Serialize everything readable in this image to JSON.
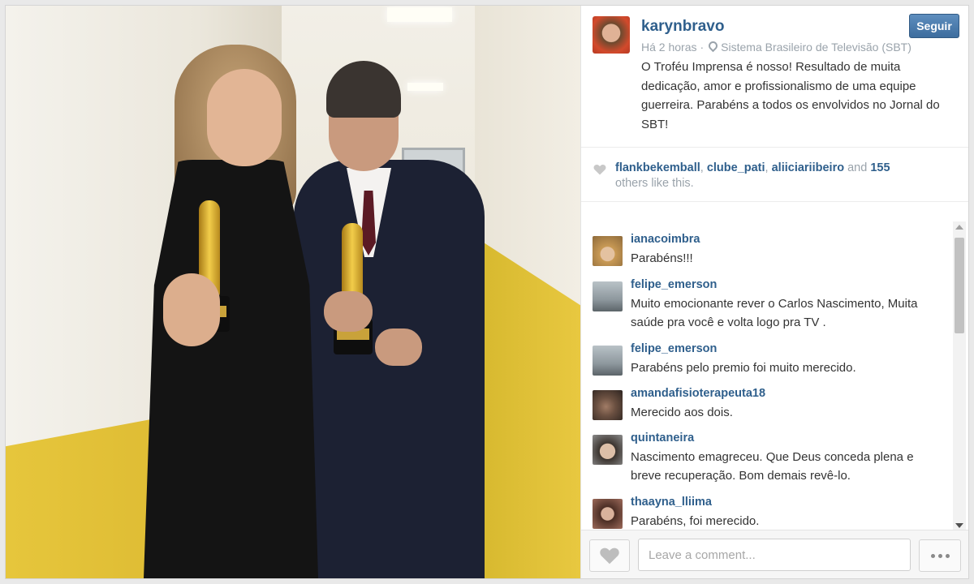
{
  "post": {
    "username": "karynbravo",
    "follow_label": "Seguir",
    "time_ago": "Há 2 horas",
    "location": "Sistema Brasileiro de Televisão (SBT)",
    "caption": "O Troféu Imprensa é nosso! Resultado de muita dedicação, amor e profissionalismo de uma equipe guerreira. Parabéns a todos os envolvidos no Jornal do SBT!",
    "photo_icon": "photo-two-people-holding-trophies"
  },
  "likes": {
    "user1": "flankbekemball",
    "user2": "clube_pati",
    "user3": "aliiciariibeiro",
    "and_label": "and",
    "others_count": "155",
    "others_suffix": "others like this."
  },
  "comments": [
    {
      "user": "ianacoimbra",
      "text": "Parabéns!!!"
    },
    {
      "user": "felipe_emerson",
      "text": "Muito emocionante rever o Carlos Nascimento, Muita saúde pra você e volta logo pra TV ."
    },
    {
      "user": "felipe_emerson",
      "text": "Parabéns pelo premio foi muito merecido."
    },
    {
      "user": "amandafisioterapeuta18",
      "text": "Merecido aos dois."
    },
    {
      "user": "quintaneira",
      "text": "Nascimento emagreceu. Que Deus conceda plena e breve recuperação. Bom demais revê-lo."
    },
    {
      "user": "thaayna_lliima",
      "text": "Parabéns, foi merecido."
    }
  ],
  "footer": {
    "comment_placeholder": "Leave a comment...",
    "like_icon": "heart-icon",
    "more_icon": "ellipsis-icon"
  },
  "colors": {
    "link_blue": "#2f5f8c",
    "follow_button": "#4a7aab",
    "muted_text": "#9aa3ab"
  }
}
